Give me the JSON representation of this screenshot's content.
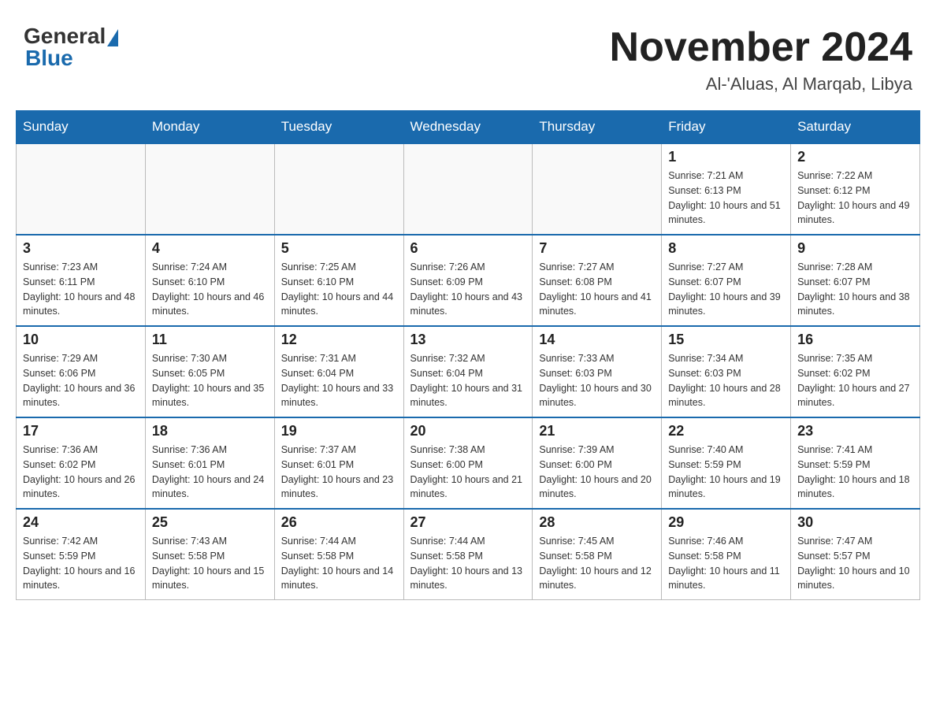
{
  "header": {
    "logo_general": "General",
    "logo_blue": "Blue",
    "month_title": "November 2024",
    "location": "Al-'Aluas, Al Marqab, Libya"
  },
  "weekdays": [
    "Sunday",
    "Monday",
    "Tuesday",
    "Wednesday",
    "Thursday",
    "Friday",
    "Saturday"
  ],
  "weeks": [
    {
      "days": [
        {
          "num": "",
          "info": ""
        },
        {
          "num": "",
          "info": ""
        },
        {
          "num": "",
          "info": ""
        },
        {
          "num": "",
          "info": ""
        },
        {
          "num": "",
          "info": ""
        },
        {
          "num": "1",
          "info": "Sunrise: 7:21 AM\nSunset: 6:13 PM\nDaylight: 10 hours and 51 minutes."
        },
        {
          "num": "2",
          "info": "Sunrise: 7:22 AM\nSunset: 6:12 PM\nDaylight: 10 hours and 49 minutes."
        }
      ]
    },
    {
      "days": [
        {
          "num": "3",
          "info": "Sunrise: 7:23 AM\nSunset: 6:11 PM\nDaylight: 10 hours and 48 minutes."
        },
        {
          "num": "4",
          "info": "Sunrise: 7:24 AM\nSunset: 6:10 PM\nDaylight: 10 hours and 46 minutes."
        },
        {
          "num": "5",
          "info": "Sunrise: 7:25 AM\nSunset: 6:10 PM\nDaylight: 10 hours and 44 minutes."
        },
        {
          "num": "6",
          "info": "Sunrise: 7:26 AM\nSunset: 6:09 PM\nDaylight: 10 hours and 43 minutes."
        },
        {
          "num": "7",
          "info": "Sunrise: 7:27 AM\nSunset: 6:08 PM\nDaylight: 10 hours and 41 minutes."
        },
        {
          "num": "8",
          "info": "Sunrise: 7:27 AM\nSunset: 6:07 PM\nDaylight: 10 hours and 39 minutes."
        },
        {
          "num": "9",
          "info": "Sunrise: 7:28 AM\nSunset: 6:07 PM\nDaylight: 10 hours and 38 minutes."
        }
      ]
    },
    {
      "days": [
        {
          "num": "10",
          "info": "Sunrise: 7:29 AM\nSunset: 6:06 PM\nDaylight: 10 hours and 36 minutes."
        },
        {
          "num": "11",
          "info": "Sunrise: 7:30 AM\nSunset: 6:05 PM\nDaylight: 10 hours and 35 minutes."
        },
        {
          "num": "12",
          "info": "Sunrise: 7:31 AM\nSunset: 6:04 PM\nDaylight: 10 hours and 33 minutes."
        },
        {
          "num": "13",
          "info": "Sunrise: 7:32 AM\nSunset: 6:04 PM\nDaylight: 10 hours and 31 minutes."
        },
        {
          "num": "14",
          "info": "Sunrise: 7:33 AM\nSunset: 6:03 PM\nDaylight: 10 hours and 30 minutes."
        },
        {
          "num": "15",
          "info": "Sunrise: 7:34 AM\nSunset: 6:03 PM\nDaylight: 10 hours and 28 minutes."
        },
        {
          "num": "16",
          "info": "Sunrise: 7:35 AM\nSunset: 6:02 PM\nDaylight: 10 hours and 27 minutes."
        }
      ]
    },
    {
      "days": [
        {
          "num": "17",
          "info": "Sunrise: 7:36 AM\nSunset: 6:02 PM\nDaylight: 10 hours and 26 minutes."
        },
        {
          "num": "18",
          "info": "Sunrise: 7:36 AM\nSunset: 6:01 PM\nDaylight: 10 hours and 24 minutes."
        },
        {
          "num": "19",
          "info": "Sunrise: 7:37 AM\nSunset: 6:01 PM\nDaylight: 10 hours and 23 minutes."
        },
        {
          "num": "20",
          "info": "Sunrise: 7:38 AM\nSunset: 6:00 PM\nDaylight: 10 hours and 21 minutes."
        },
        {
          "num": "21",
          "info": "Sunrise: 7:39 AM\nSunset: 6:00 PM\nDaylight: 10 hours and 20 minutes."
        },
        {
          "num": "22",
          "info": "Sunrise: 7:40 AM\nSunset: 5:59 PM\nDaylight: 10 hours and 19 minutes."
        },
        {
          "num": "23",
          "info": "Sunrise: 7:41 AM\nSunset: 5:59 PM\nDaylight: 10 hours and 18 minutes."
        }
      ]
    },
    {
      "days": [
        {
          "num": "24",
          "info": "Sunrise: 7:42 AM\nSunset: 5:59 PM\nDaylight: 10 hours and 16 minutes."
        },
        {
          "num": "25",
          "info": "Sunrise: 7:43 AM\nSunset: 5:58 PM\nDaylight: 10 hours and 15 minutes."
        },
        {
          "num": "26",
          "info": "Sunrise: 7:44 AM\nSunset: 5:58 PM\nDaylight: 10 hours and 14 minutes."
        },
        {
          "num": "27",
          "info": "Sunrise: 7:44 AM\nSunset: 5:58 PM\nDaylight: 10 hours and 13 minutes."
        },
        {
          "num": "28",
          "info": "Sunrise: 7:45 AM\nSunset: 5:58 PM\nDaylight: 10 hours and 12 minutes."
        },
        {
          "num": "29",
          "info": "Sunrise: 7:46 AM\nSunset: 5:58 PM\nDaylight: 10 hours and 11 minutes."
        },
        {
          "num": "30",
          "info": "Sunrise: 7:47 AM\nSunset: 5:57 PM\nDaylight: 10 hours and 10 minutes."
        }
      ]
    }
  ]
}
